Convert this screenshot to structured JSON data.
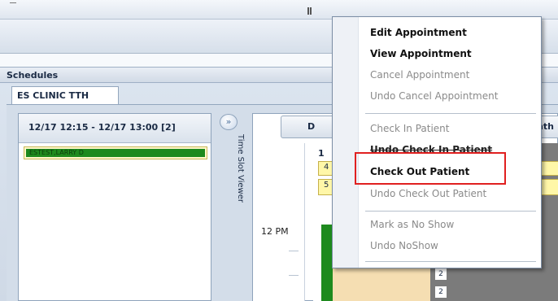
{
  "schedules": {
    "title": "Schedules",
    "tab_label": "ES CLINIC TTH"
  },
  "time_slot": {
    "header": "12/17 12:15 - 12/17 13:00  [2]",
    "patient": "ESTEST,LARRY D",
    "patient_bar_color": "#1e8a1e",
    "viewer_label": "Time Slot Viewer",
    "arrow": "»"
  },
  "calendar": {
    "day_button": "D",
    "month_button": "nth",
    "time_label": "12 PM",
    "head_num": "1",
    "rows": [
      "4",
      "5"
    ],
    "small_nums": [
      "2",
      "2"
    ]
  },
  "context_menu": {
    "items": [
      {
        "label": "Edit Appointment",
        "state": "enabled"
      },
      {
        "label": "View Appointment",
        "state": "enabled"
      },
      {
        "label": "Cancel Appointment",
        "state": "disabled"
      },
      {
        "label": "Undo Cancel Appointment",
        "state": "disabled"
      },
      {
        "label": "Check In Patient",
        "state": "disabled"
      },
      {
        "label": "Undo Check In Patient",
        "state": "strike"
      },
      {
        "label": "Check Out Patient",
        "state": "enabled"
      },
      {
        "label": "Undo Check Out Patient",
        "state": "disabled"
      },
      {
        "label": "Mark as No Show",
        "state": "disabled"
      },
      {
        "label": "Undo NoShow",
        "state": "disabled"
      }
    ],
    "highlighted_item": "Check Out Patient",
    "highlight_color": "#e02020"
  }
}
